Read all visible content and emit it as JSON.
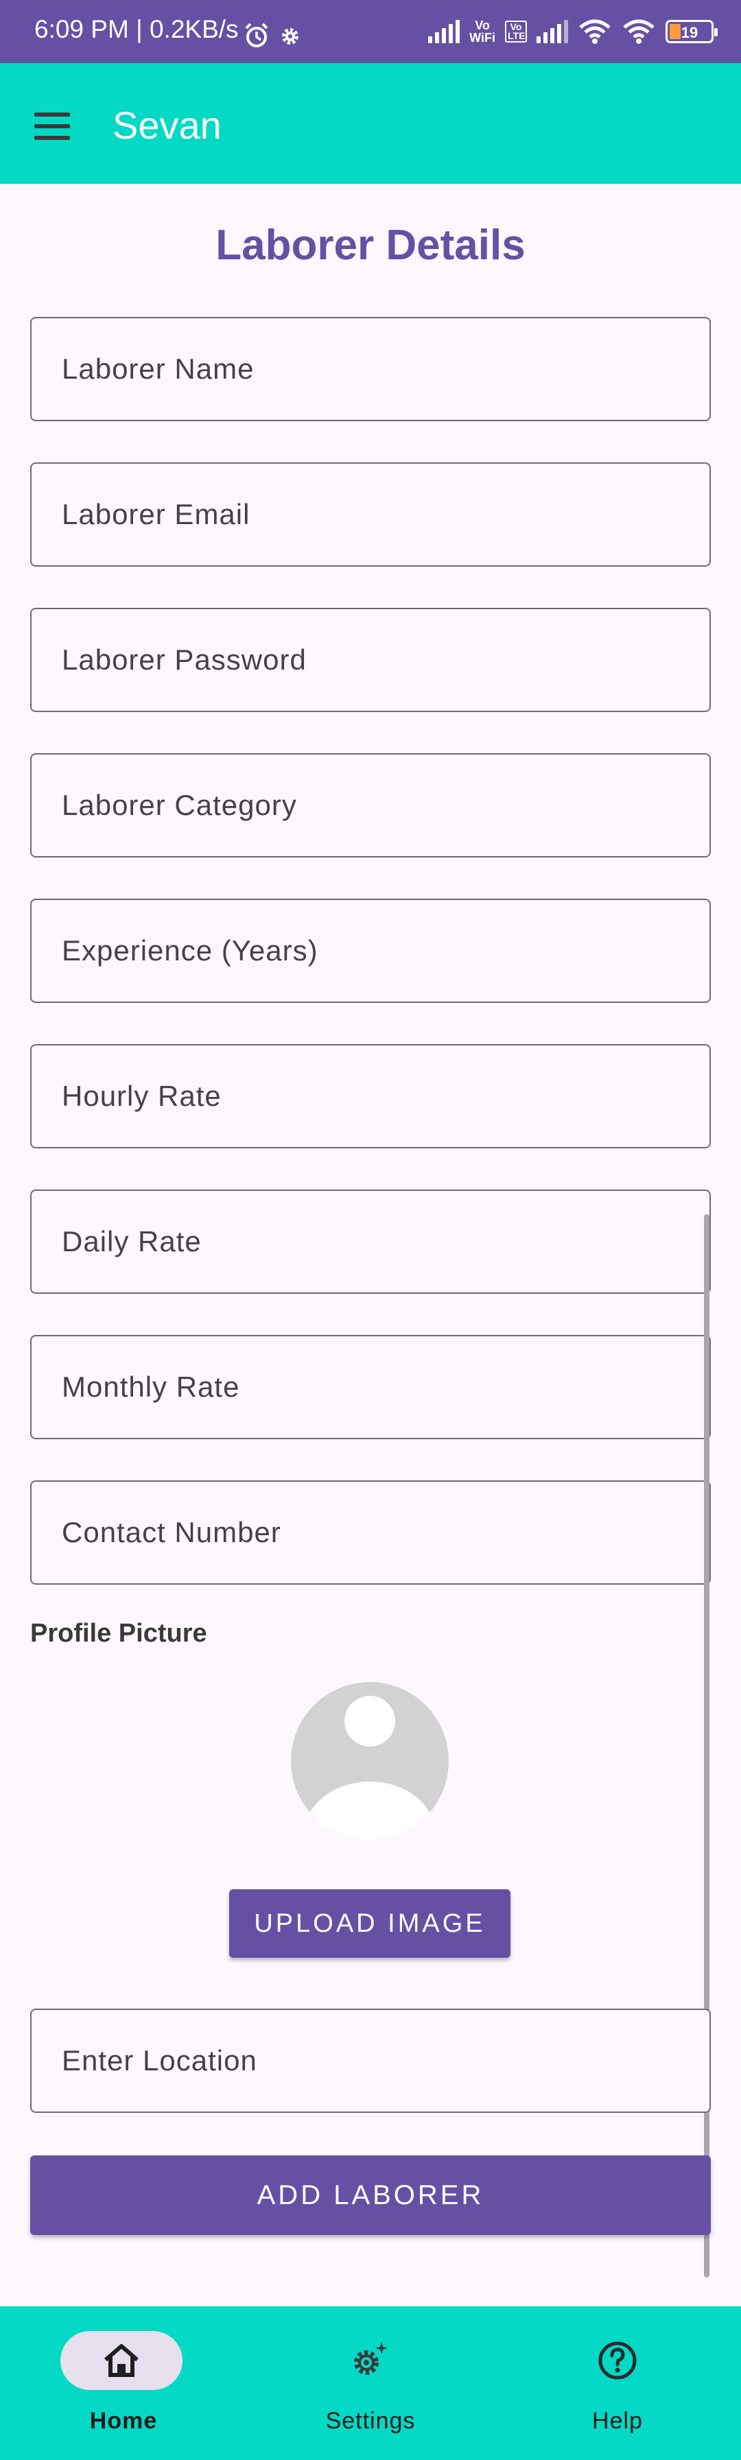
{
  "status_bar": {
    "time_speed": "6:09 PM | 0.2KB/s",
    "vowifi_top": "Vo",
    "vowifi_bottom": "WiFi",
    "volte": "Vo LTE",
    "battery": "19"
  },
  "app_bar": {
    "title": "Sevan"
  },
  "page": {
    "title": "Laborer Details"
  },
  "form": {
    "fields": [
      {
        "placeholder": "Laborer Name"
      },
      {
        "placeholder": "Laborer Email"
      },
      {
        "placeholder": "Laborer Password"
      },
      {
        "placeholder": "Laborer Category"
      },
      {
        "placeholder": "Experience (Years)"
      },
      {
        "placeholder": "Hourly Rate"
      },
      {
        "placeholder": "Daily Rate"
      },
      {
        "placeholder": "Monthly Rate"
      },
      {
        "placeholder": "Contact Number"
      }
    ],
    "profile_label": "Profile Picture",
    "upload_button": "UPLOAD IMAGE",
    "location_placeholder": "Enter Location",
    "submit_button": "ADD LABORER"
  },
  "bottom_nav": {
    "items": [
      {
        "label": "Home",
        "icon": "home-icon",
        "active": true
      },
      {
        "label": "Settings",
        "icon": "settings-icon",
        "active": false
      },
      {
        "label": "Help",
        "icon": "help-icon",
        "active": false
      }
    ]
  },
  "colors": {
    "primary": "#6650a4",
    "accent": "#03d9c5",
    "background": "#fdf7fe"
  }
}
